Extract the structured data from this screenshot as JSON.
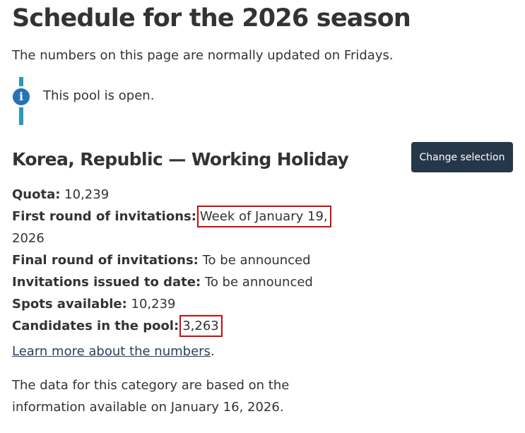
{
  "header": {
    "title": "Schedule for the 2026 season",
    "subtitle": "The numbers on this page are normally updated on Fridays."
  },
  "notice": {
    "icon": "info-icon",
    "icon_glyph": "i",
    "text": "This pool is open.",
    "bar_color": "#269abc",
    "icon_color": "#2572b4"
  },
  "pool": {
    "title": "Korea, Republic — Working Holiday",
    "change_button_label": "Change selection"
  },
  "facts": {
    "quota_label": "Quota:",
    "quota_value": "10,239",
    "first_round_label": "First round of invitations:",
    "first_round_value_line1": "Week of January 19,",
    "first_round_value_line2": "2026",
    "final_round_label": "Final round of invitations:",
    "final_round_value": "To be announced",
    "issued_label": "Invitations issued to date:",
    "issued_value": "To be announced",
    "spots_label": "Spots available:",
    "spots_value": "10,239",
    "candidates_label": "Candidates in the pool:",
    "candidates_value": "3,263"
  },
  "learn_more": {
    "link_text": "Learn more about the numbers",
    "trailing": "."
  },
  "based_on": {
    "text": "The data for this category are based on the information available on January 16, 2026."
  },
  "colors": {
    "highlight_box": "#d3080c",
    "button_bg": "#26374a",
    "link": "#284162"
  }
}
